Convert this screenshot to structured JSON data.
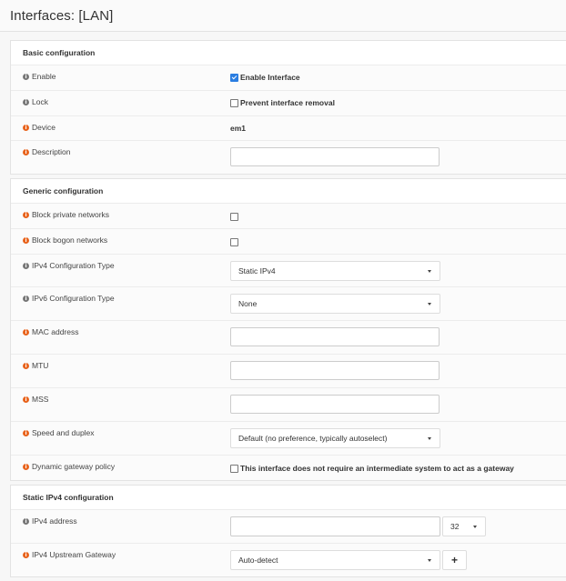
{
  "page": {
    "title": "Interfaces: [LAN]"
  },
  "sections": {
    "basic": {
      "title": "Basic configuration",
      "enable": {
        "label": "Enable",
        "checkbox_label": "Enable Interface",
        "checked": true
      },
      "lock": {
        "label": "Lock",
        "checkbox_label": "Prevent interface removal",
        "checked": false
      },
      "device": {
        "label": "Device",
        "value": "em1"
      },
      "description": {
        "label": "Description",
        "value": ""
      }
    },
    "generic": {
      "title": "Generic configuration",
      "block_private": {
        "label": "Block private networks",
        "checked": false
      },
      "block_bogon": {
        "label": "Block bogon networks",
        "checked": false
      },
      "ipv4_type": {
        "label": "IPv4 Configuration Type",
        "value": "Static IPv4"
      },
      "ipv6_type": {
        "label": "IPv6 Configuration Type",
        "value": "None"
      },
      "mac": {
        "label": "MAC address",
        "value": ""
      },
      "mtu": {
        "label": "MTU",
        "value": ""
      },
      "mss": {
        "label": "MSS",
        "value": ""
      },
      "speed": {
        "label": "Speed and duplex",
        "value": "Default (no preference, typically autoselect)"
      },
      "dyn_gw": {
        "label": "Dynamic gateway policy",
        "checkbox_label": "This interface does not require an intermediate system to act as a gateway",
        "checked": false
      }
    },
    "static_ipv4": {
      "title": "Static IPv4 configuration",
      "address": {
        "label": "IPv4 address",
        "value": "",
        "prefix": "32"
      },
      "gateway": {
        "label": "IPv4 Upstream Gateway",
        "value": "Auto-detect",
        "add_label": "+"
      }
    }
  },
  "icons": {
    "info": "info-circle-icon"
  },
  "colors": {
    "info_gray": "#777777",
    "info_orange": "#e8631c",
    "checkbox_checked": "#2a7de1"
  }
}
